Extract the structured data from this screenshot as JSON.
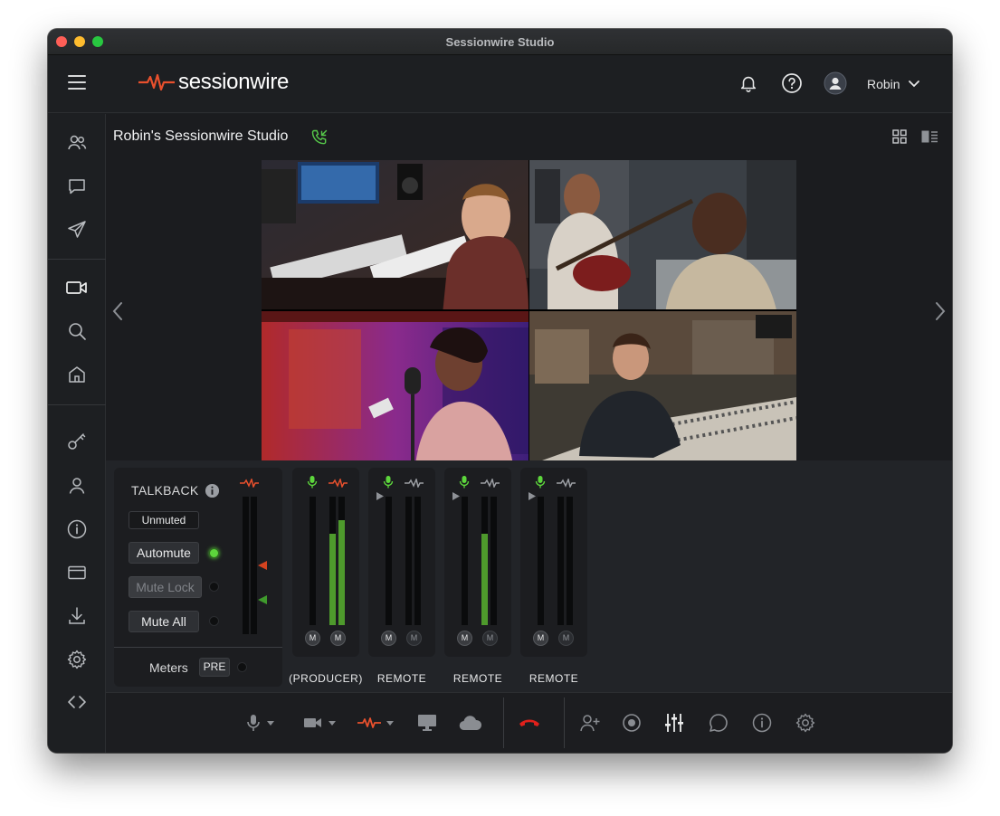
{
  "window": {
    "title": "Sessionwire Studio"
  },
  "header": {
    "logo_text": "sessionwire",
    "user_name": "Robin",
    "accent_color": "#e8502d"
  },
  "sidebar": {
    "items": [
      {
        "icon": "users-icon"
      },
      {
        "icon": "chat-icon"
      },
      {
        "icon": "send-icon"
      },
      {
        "icon": "video-camera-icon"
      },
      {
        "icon": "search-icon"
      },
      {
        "icon": "home-icon"
      },
      {
        "icon": "key-icon"
      },
      {
        "icon": "user-icon"
      },
      {
        "icon": "info-icon"
      },
      {
        "icon": "card-icon"
      },
      {
        "icon": "download-icon"
      },
      {
        "icon": "gear-icon"
      },
      {
        "icon": "code-icon"
      }
    ]
  },
  "studio": {
    "title": "Robin's Sessionwire Studio"
  },
  "talkback": {
    "label": "TALKBACK",
    "status": "Unmuted",
    "automute": "Automute",
    "mute_lock": "Mute Lock",
    "mute_all": "Mute All",
    "automute_active": true,
    "meters_label": "Meters",
    "meters_mode": "PRE"
  },
  "strips": [
    {
      "label": "(PRODUCER)",
      "levels": [
        0.0,
        0.71,
        0.82
      ],
      "m1": "M",
      "m2": "M"
    },
    {
      "label": "REMOTE",
      "levels": [
        0.0,
        0.0,
        0.0
      ],
      "m1": "M",
      "m2": "M"
    },
    {
      "label": "REMOTE",
      "levels": [
        0.0,
        0.71,
        0.0
      ],
      "m1": "M",
      "m2": "M"
    },
    {
      "label": "REMOTE",
      "levels": [
        0.0,
        0.0,
        0.0
      ],
      "m1": "M",
      "m2": "M"
    }
  ],
  "toolbar": {
    "end_call_color": "#e0201b"
  }
}
